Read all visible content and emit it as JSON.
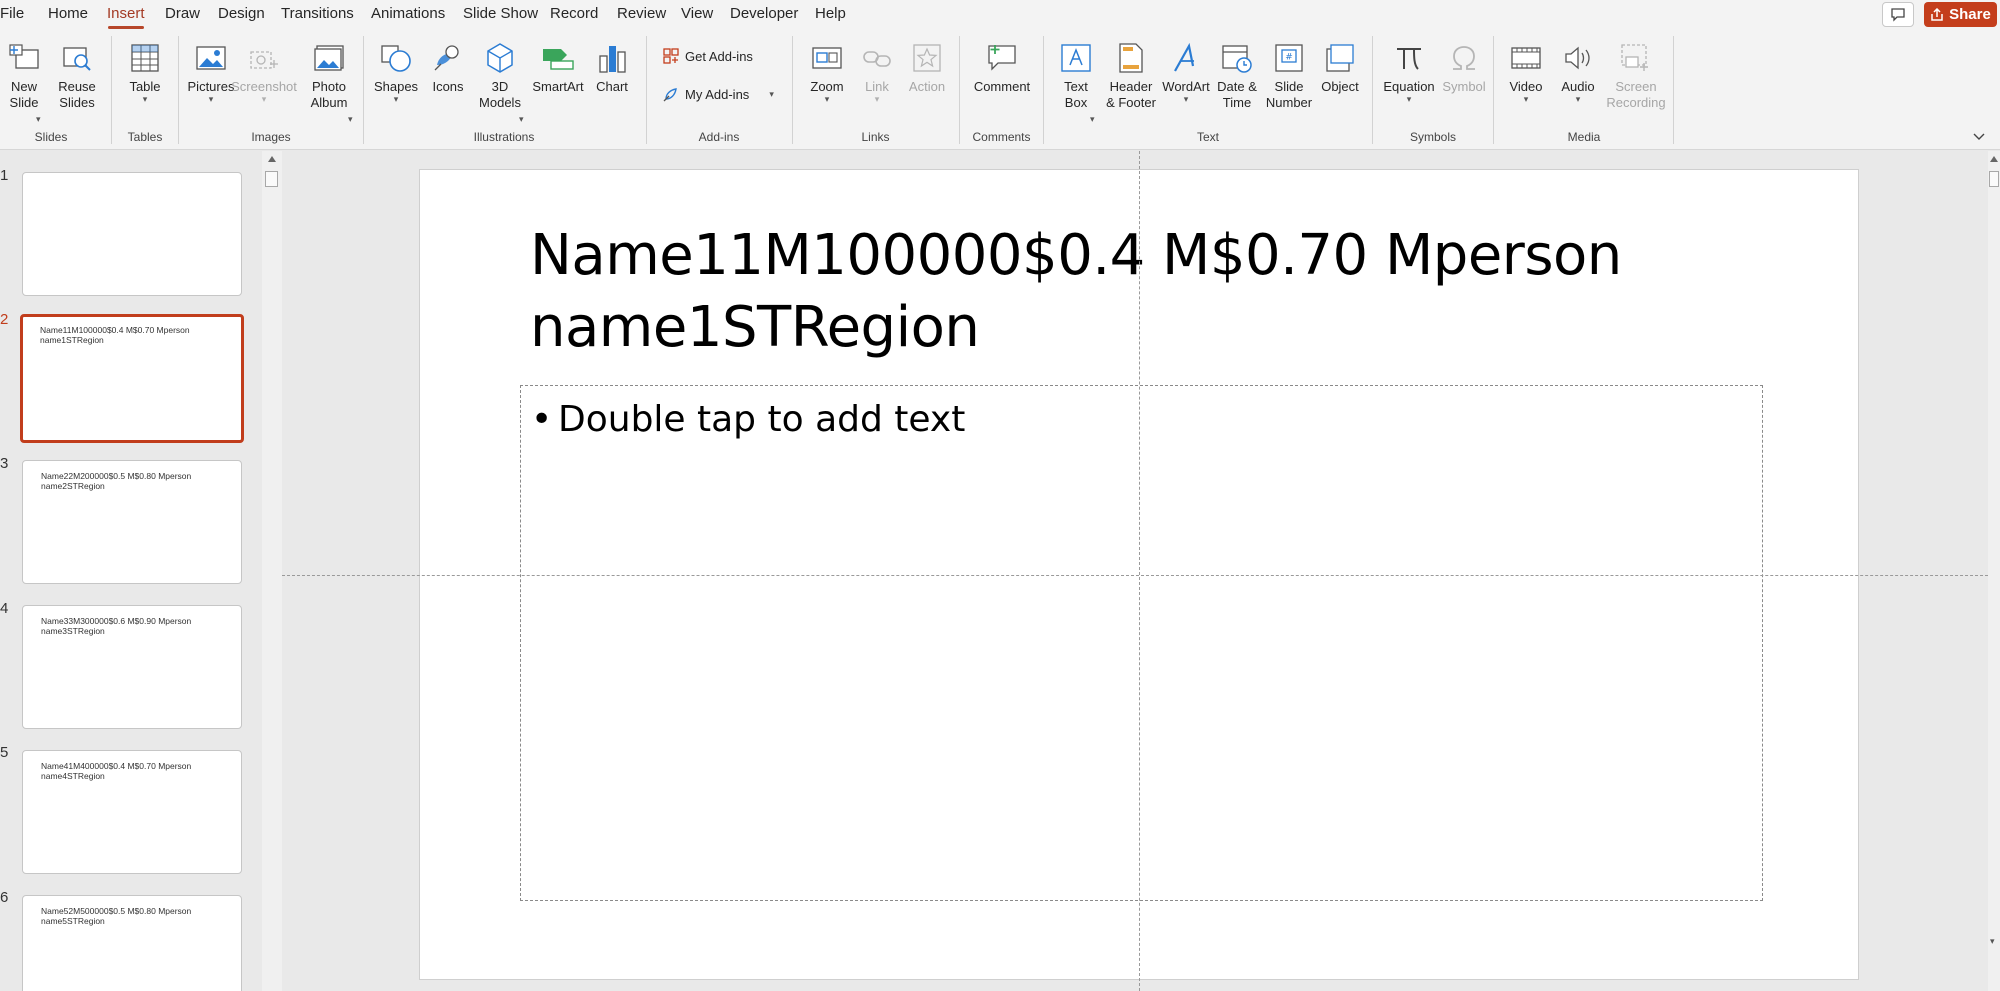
{
  "tabs": [
    {
      "label": "File",
      "active": false
    },
    {
      "label": "Home",
      "active": false
    },
    {
      "label": "Insert",
      "active": true
    },
    {
      "label": "Draw",
      "active": false
    },
    {
      "label": "Design",
      "active": false
    },
    {
      "label": "Transitions",
      "active": false
    },
    {
      "label": "Animations",
      "active": false
    },
    {
      "label": "Slide Show",
      "active": false
    },
    {
      "label": "Record",
      "active": false
    },
    {
      "label": "Review",
      "active": false
    },
    {
      "label": "View",
      "active": false
    },
    {
      "label": "Developer",
      "active": false
    },
    {
      "label": "Help",
      "active": false
    }
  ],
  "share": {
    "label": "Share"
  },
  "ribbon": {
    "slides": {
      "title": "Slides",
      "new_slide": "New\nSlide",
      "reuse_slides": "Reuse\nSlides"
    },
    "tables": {
      "title": "Tables",
      "table": "Table"
    },
    "images": {
      "title": "Images",
      "pictures": "Pictures",
      "screenshot": "Screenshot",
      "photo_album": "Photo\nAlbum"
    },
    "illustrations": {
      "title": "Illustrations",
      "shapes": "Shapes",
      "icons": "Icons",
      "models_3d": "3D\nModels",
      "smartart": "SmartArt",
      "chart": "Chart"
    },
    "addins": {
      "title": "Add-ins",
      "get_addins": "Get Add-ins",
      "my_addins": "My Add-ins"
    },
    "links": {
      "title": "Links",
      "zoom": "Zoom",
      "link": "Link",
      "action": "Action"
    },
    "comments": {
      "title": "Comments",
      "comment": "Comment"
    },
    "text": {
      "title": "Text",
      "text_box": "Text\nBox",
      "header_footer": "Header\n& Footer",
      "wordart": "WordArt",
      "date_time": "Date &\nTime",
      "slide_number": "Slide\nNumber",
      "object": "Object"
    },
    "symbols": {
      "title": "Symbols",
      "equation": "Equation",
      "symbol": "Symbol"
    },
    "media": {
      "title": "Media",
      "video": "Video",
      "audio": "Audio",
      "screen_recording": "Screen\nRecording"
    }
  },
  "thumbnails": [
    {
      "number": "1",
      "text": "",
      "active": false
    },
    {
      "number": "2",
      "text": "Name11M100000$0.4 M$0.70 Mperson\nname1STRegion",
      "active": true
    },
    {
      "number": "3",
      "text": "Name22M200000$0.5 M$0.80 Mperson\nname2STRegion",
      "active": false
    },
    {
      "number": "4",
      "text": "Name33M300000$0.6 M$0.90 Mperson\nname3STRegion",
      "active": false
    },
    {
      "number": "5",
      "text": "Name41M400000$0.4 M$0.70 Mperson\nname4STRegion",
      "active": false
    },
    {
      "number": "6",
      "text": "Name52M500000$0.5 M$0.80 Mperson\nname5STRegion",
      "active": false
    }
  ],
  "slide": {
    "title": "Name11M100000$0.4 M$0.70 Mperson\nname1STRegion",
    "bullet": "•",
    "placeholder": "Double tap to add text"
  },
  "colors": {
    "accent": "#b7472a",
    "share_bg": "#c43e1c",
    "active_thumb_border": "#c13d1c"
  }
}
